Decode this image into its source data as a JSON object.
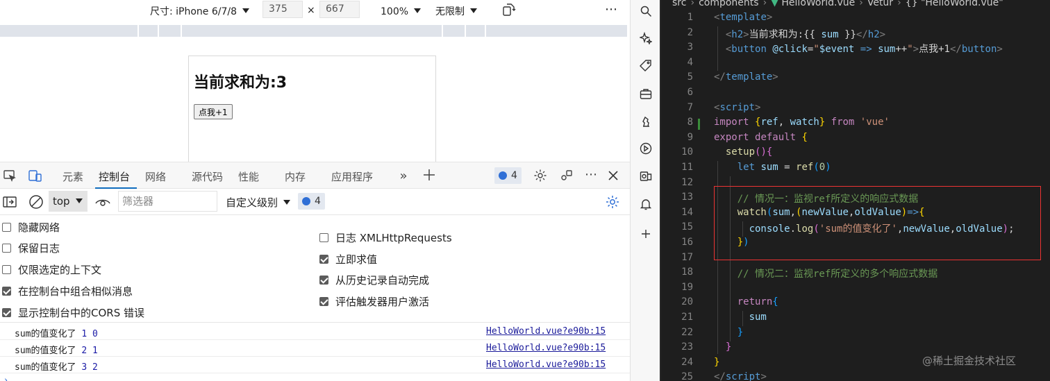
{
  "device_toolbar": {
    "dimensions_label": "尺寸: iPhone 6/7/8",
    "width": "375",
    "times": "×",
    "height": "667",
    "zoom": "100%",
    "throttle": "无限制",
    "more": "⋯"
  },
  "page": {
    "heading": "当前求和为:3",
    "button": "点我+1"
  },
  "devtools_tabs": {
    "tabs": [
      "元素",
      "控制台",
      "网络",
      "源代码",
      "性能",
      "内存",
      "应用程序"
    ],
    "active": "控制台",
    "message_count": "4"
  },
  "console_toolbar": {
    "context": "top",
    "filter_placeholder": "筛选器",
    "level": "自定义级别",
    "message_count": "4"
  },
  "settings": {
    "left": [
      {
        "label": "隐藏网络",
        "checked": false
      },
      {
        "label": "保留日志",
        "checked": false
      },
      {
        "label": "仅限选定的上下文",
        "checked": false
      },
      {
        "label": "在控制台中组合相似消息",
        "checked": true
      },
      {
        "label": "显示控制台中的CORS 错误",
        "checked": true
      }
    ],
    "right": [
      {
        "label": "日志 XMLHttpRequests",
        "checked": false
      },
      {
        "label": "立即求值",
        "checked": true
      },
      {
        "label": "从历史记录自动完成",
        "checked": true
      },
      {
        "label": "评估触发器用户激活",
        "checked": true
      }
    ]
  },
  "console_logs": [
    {
      "text": "sum的值变化了",
      "a": "1",
      "b": "0",
      "source": "HelloWorld.vue?e90b:15"
    },
    {
      "text": "sum的值变化了",
      "a": "2",
      "b": "1",
      "source": "HelloWorld.vue?e90b:15"
    },
    {
      "text": "sum的值变化了",
      "a": "3",
      "b": "2",
      "source": "HelloWorld.vue?e90b:15"
    }
  ],
  "editor": {
    "breadcrumb": [
      "src",
      "components",
      "HelloWorld.vue",
      "Vetur",
      "{} \"HelloWorld.vue\""
    ],
    "line_numbers": [
      "1",
      "2",
      "3",
      "4",
      "5",
      "6",
      "7",
      "8",
      "9",
      "10",
      "11",
      "12",
      "13",
      "14",
      "15",
      "16",
      "17",
      "18",
      "19",
      "20",
      "21",
      "22",
      "23",
      "24",
      "25"
    ],
    "watermark": "@稀土掘金技术社区",
    "colors": {
      "background": "#1e1e1e",
      "highlight_box": "#ee3333",
      "comment": "#6a9955",
      "tag": "#569cd6"
    }
  }
}
